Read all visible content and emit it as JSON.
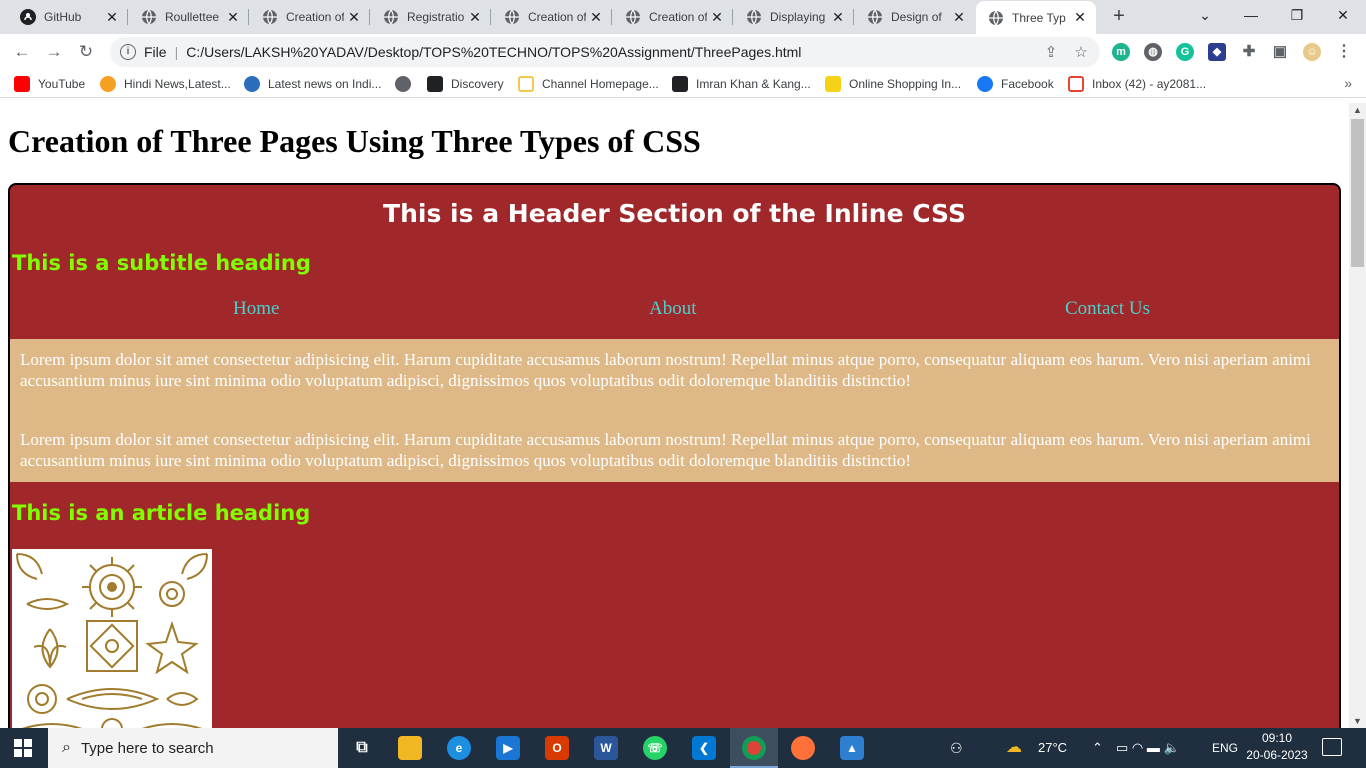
{
  "browser": {
    "tabs": [
      {
        "label": "GitHub",
        "icon": "github-icon"
      },
      {
        "label": "Roullettee",
        "icon": "globe-icon"
      },
      {
        "label": "Creation of",
        "icon": "globe-icon"
      },
      {
        "label": "Registratio",
        "icon": "globe-icon"
      },
      {
        "label": "Creation of",
        "icon": "globe-icon"
      },
      {
        "label": "Creation of",
        "icon": "globe-icon"
      },
      {
        "label": "Displaying",
        "icon": "globe-icon"
      },
      {
        "label": "Design of",
        "icon": "globe-icon"
      },
      {
        "label": "Three Typ",
        "icon": "globe-icon",
        "active": true
      }
    ],
    "address": {
      "scheme": "File",
      "url": "C:/Users/LAKSH%20YADAV/Desktop/TOPS%20TECHNO/TOPS%20Assignment/ThreePages.html"
    },
    "bookmarks": [
      {
        "label": "YouTube",
        "color": "#ff0000"
      },
      {
        "label": "Hindi News,Latest...",
        "color": "#f4a020"
      },
      {
        "label": "Latest news on Indi...",
        "color": "#2a6ebb"
      },
      {
        "label": "",
        "color": "#5f6368"
      },
      {
        "label": "Discovery",
        "color": "#202124"
      },
      {
        "label": "Channel Homepage...",
        "color": "#f2c94c"
      },
      {
        "label": "Imran Khan & Kang...",
        "color": "#202124"
      },
      {
        "label": "Online Shopping In...",
        "color": "#f7d117"
      },
      {
        "label": "Facebook",
        "color": "#1877f2"
      },
      {
        "label": "Inbox (42) - ay2081...",
        "color": "#ea4335"
      }
    ]
  },
  "page": {
    "title": "Creation of Three Pages Using Three Types of CSS",
    "header": "This is a Header Section of the Inline CSS",
    "subtitle": "This is a subtitle heading",
    "nav": {
      "home": "Home",
      "about": "About",
      "contact": "Contact Us"
    },
    "paragraphs": [
      "Lorem ipsum dolor sit amet consectetur adipisicing elit. Harum cupiditate accusamus laborum nostrum! Repellat minus atque porro, consequatur aliquam eos harum. Vero nisi aperiam animi accusantium minus iure sint minima odio voluptatum adipisci, dignissimos quos voluptatibus odit doloremque blanditiis distinctio!",
      "Lorem ipsum dolor sit amet consectetur adipisicing elit. Harum cupiditate accusamus laborum nostrum! Repellat minus atque porro, consequatur aliquam eos harum. Vero nisi aperiam animi accusantium minus iure sint minima odio voluptatum adipisci, dignissimos quos voluptatibus odit doloremque blanditiis distinctio!"
    ],
    "article_heading": "This is an article heading",
    "colors": {
      "panel": "#a0282a",
      "content": "#deb887",
      "heading": "#7fff00",
      "links": "#48d1cc"
    }
  },
  "taskbar": {
    "search_placeholder": "Type here to search",
    "weather": "27°C",
    "language": "ENG",
    "time": "09:10",
    "date": "20-06-2023"
  }
}
